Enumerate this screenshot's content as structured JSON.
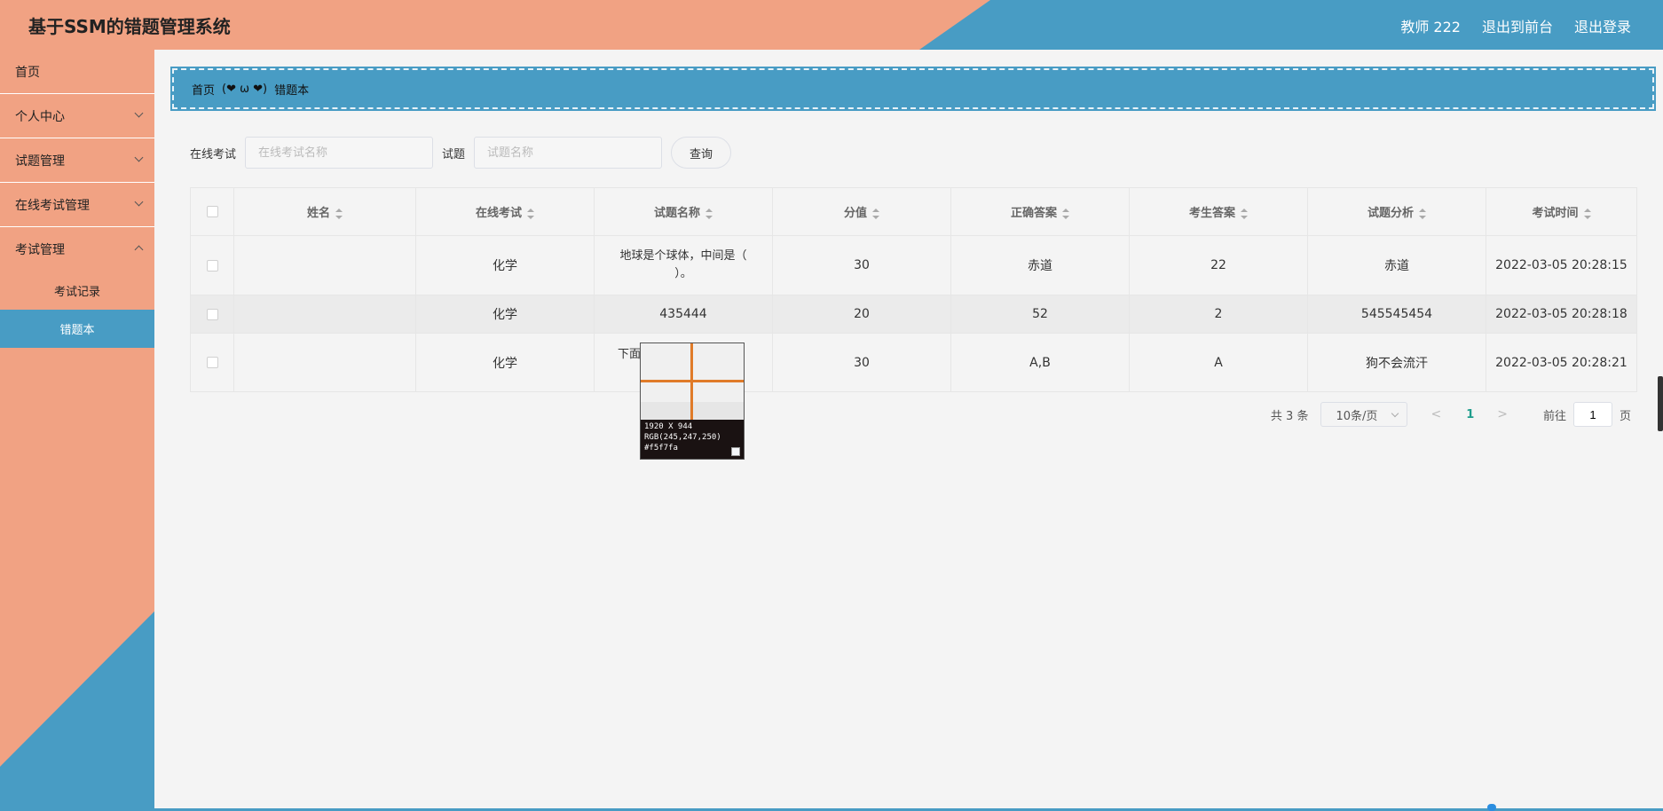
{
  "header": {
    "title": "基于SSM的错题管理系统",
    "links": [
      "教师 222",
      "退出到前台",
      "退出登录"
    ]
  },
  "sidebar": {
    "items": [
      {
        "label": "首页"
      },
      {
        "label": "个人中心"
      },
      {
        "label": "试题管理"
      },
      {
        "label": "在线考试管理"
      },
      {
        "label": "考试管理"
      }
    ],
    "sub_items": [
      {
        "label": "考试记录",
        "active": false
      },
      {
        "label": "错题本",
        "active": true
      }
    ]
  },
  "breadcrumb": {
    "home": "首页",
    "separator": "(❤ ω ❤)",
    "current": "错题本"
  },
  "search": {
    "exam_label": "在线考试",
    "exam_placeholder": "在线考试名称",
    "question_label": "试题",
    "question_placeholder": "试题名称",
    "query_button": "查询"
  },
  "table": {
    "columns": [
      "姓名",
      "在线考试",
      "试题名称",
      "分值",
      "正确答案",
      "考生答案",
      "试题分析",
      "考试时间"
    ],
    "rows": [
      {
        "name": "",
        "exam": "化学",
        "question": "地球是个球体，中间是（ ）。",
        "score": "30",
        "correct": "赤道",
        "answer": "22",
        "analysis": "赤道",
        "time": "2022-03-05 20:28:15"
      },
      {
        "name": "",
        "exam": "化学",
        "question": "435444",
        "score": "20",
        "correct": "52",
        "answer": "2",
        "analysis": "545545454",
        "time": "2022-03-05 20:28:18"
      },
      {
        "name": "",
        "exam": "化学",
        "question": "下面",
        "score": "30",
        "correct": "A,B",
        "answer": "A",
        "analysis": "狗不会流汗",
        "time": "2022-03-05 20:28:21"
      }
    ]
  },
  "pagination": {
    "total": "共 3 条",
    "page_size": "10条/页",
    "prev": "<",
    "current_page": "1",
    "next": ">",
    "goto_label": "前往",
    "goto_value": "1",
    "unit": "页"
  },
  "magnifier": {
    "line1": "1920 X 944",
    "line2": "RGB(245,247,250)",
    "line3": "#f5f7fa"
  },
  "colors": {
    "accent_blue": "#489cc4",
    "accent_salmon": "#f1a283",
    "page_number": "#1f9d8c"
  }
}
